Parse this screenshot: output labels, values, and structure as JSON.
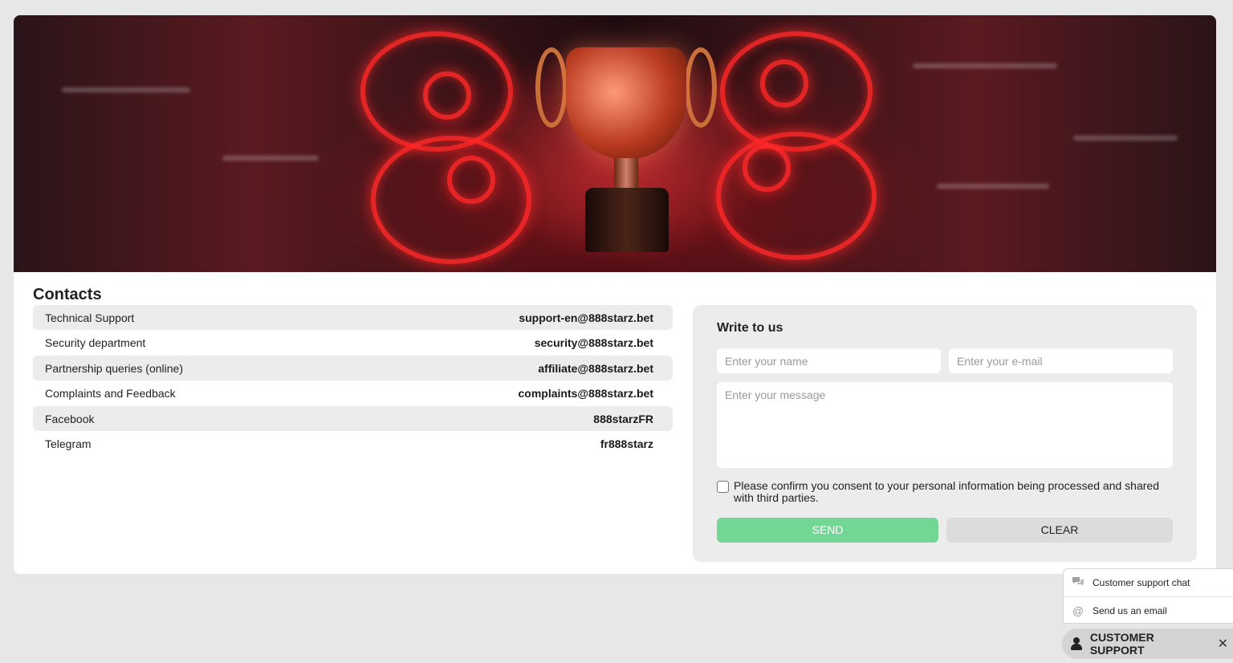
{
  "banner": {
    "alt": "888 trophy banner"
  },
  "contacts": {
    "title": "Contacts",
    "rows": [
      {
        "label": "Technical Support",
        "value": "support-en@888starz.bet"
      },
      {
        "label": "Security department",
        "value": "security@888starz.bet"
      },
      {
        "label": "Partnership queries (online)",
        "value": "affiliate@888starz.bet"
      },
      {
        "label": "Complaints and Feedback",
        "value": "complaints@888starz.bet"
      },
      {
        "label": "Facebook",
        "value": "888starzFR"
      },
      {
        "label": "Telegram",
        "value": "fr888starz"
      }
    ]
  },
  "form": {
    "title": "Write to us",
    "name_placeholder": "Enter your name",
    "email_placeholder": "Enter your e-mail",
    "message_placeholder": "Enter your message",
    "consent_text": "Please confirm you consent to your personal information being processed and shared with third parties.",
    "send_label": "SEND",
    "clear_label": "CLEAR"
  },
  "support": {
    "chat_label": "Customer support chat",
    "email_label": "Send us an email",
    "bar_label": "CUSTOMER SUPPORT",
    "close_glyph": "✕"
  },
  "colors": {
    "send": "#72d694",
    "page_bg": "#e7e7e7"
  }
}
